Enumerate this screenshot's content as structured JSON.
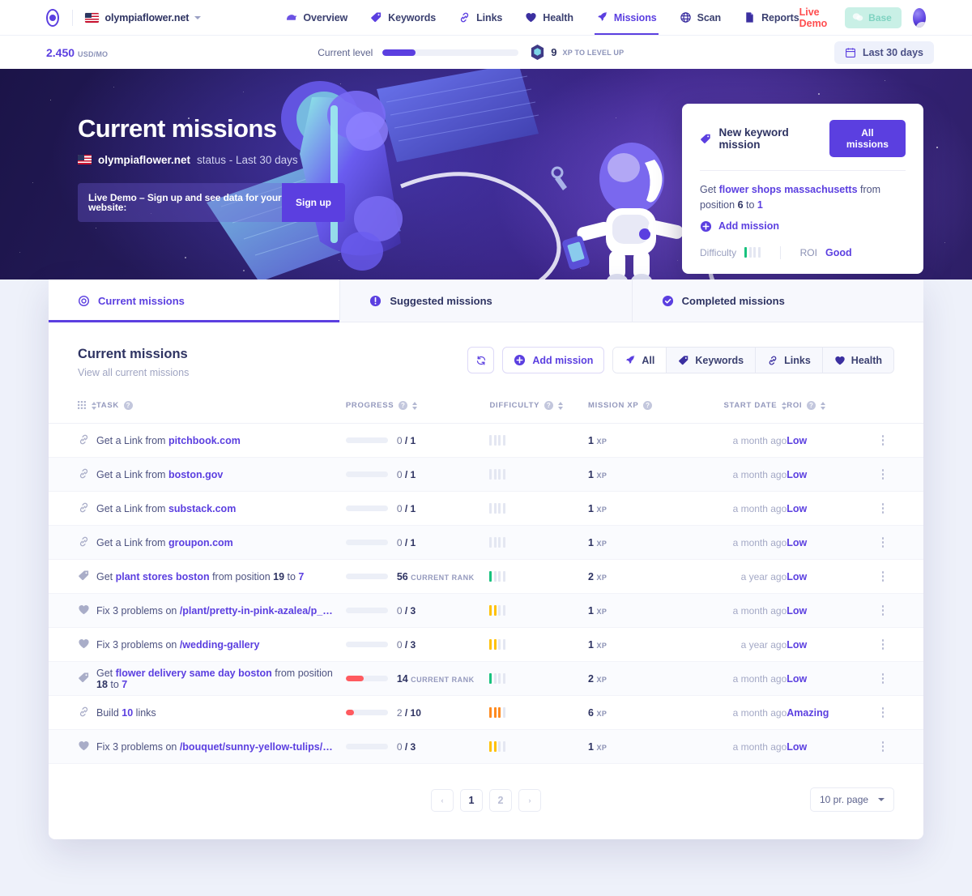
{
  "topnav": {
    "logo_icon": "target-logo-icon",
    "site": {
      "name": "olympiaflower.net",
      "flag": "us-flag-icon"
    },
    "items": [
      {
        "label": "Overview",
        "icon": "speedometer-icon",
        "active": false
      },
      {
        "label": "Keywords",
        "icon": "tag-icon",
        "active": false
      },
      {
        "label": "Links",
        "icon": "link-icon",
        "active": false
      },
      {
        "label": "Health",
        "icon": "heart-icon",
        "active": false
      },
      {
        "label": "Missions",
        "icon": "rocket-icon",
        "active": true
      },
      {
        "label": "Scan",
        "icon": "globe-icon",
        "active": false
      },
      {
        "label": "Reports",
        "icon": "document-icon",
        "active": false
      }
    ],
    "live_demo": "Live Demo",
    "plan_badge": "Base",
    "plan_icon": "chat-icon",
    "avatar": "user-avatar"
  },
  "subbar": {
    "mrr_value": "2.450",
    "mrr_unit": "USD/MO",
    "level_label": "Current level",
    "level_percent": 24,
    "xp_icon": "xp-gem-icon",
    "xp_value": "9",
    "xp_text": "XP TO LEVEL UP",
    "date_range": "Last 30 days",
    "date_icon": "calendar-icon"
  },
  "hero": {
    "title": "Current missions",
    "flag": "us-flag-icon",
    "subtitle_site": "olympiaflower.net",
    "subtitle_rest": "status - Last 30 days",
    "demo_text": "Live Demo – Sign up and see data for your website:",
    "signup_label": "Sign up"
  },
  "keyword_card": {
    "icon": "tag-icon",
    "title": "New keyword mission",
    "all_missions_label": "All missions",
    "line_prefix": "Get ",
    "keyword": "flower shops massachusetts",
    "line_mid": " from position ",
    "from_position": "6",
    "line_to": " to ",
    "to_position": "1",
    "add_mission_label": "Add mission",
    "add_icon": "plus-circle-icon",
    "difficulty_label": "Difficulty",
    "difficulty_level": 1,
    "difficulty_color": "#18c27e",
    "roi_label": "ROI",
    "roi_value": "Good"
  },
  "tabs": [
    {
      "label": "Current missions",
      "icon": "target-icon",
      "active": true
    },
    {
      "label": "Suggested missions",
      "icon": "exclamation-circle-icon",
      "active": false
    },
    {
      "label": "Completed missions",
      "icon": "check-circle-icon",
      "active": false
    }
  ],
  "panel": {
    "title": "Current missions",
    "subtitle": "View all current missions",
    "refresh_icon": "refresh-icon",
    "add_mission_label": "Add mission",
    "add_mission_icon": "plus-circle-icon",
    "filters": [
      {
        "label": "All",
        "icon": "rocket-icon",
        "active": true
      },
      {
        "label": "Keywords",
        "icon": "tag-icon",
        "active": false
      },
      {
        "label": "Links",
        "icon": "link-icon",
        "active": false
      },
      {
        "label": "Health",
        "icon": "heart-icon",
        "active": false
      }
    ]
  },
  "table": {
    "columns": [
      {
        "key": "icon",
        "label": "",
        "help": false,
        "sort": true
      },
      {
        "key": "task",
        "label": "TASK",
        "help": true,
        "sort": false
      },
      {
        "key": "progress",
        "label": "PROGRESS",
        "help": true,
        "sort": true
      },
      {
        "key": "difficulty",
        "label": "DIFFICULTY",
        "help": true,
        "sort": true
      },
      {
        "key": "xp",
        "label": "MISSION XP",
        "help": true,
        "sort": false
      },
      {
        "key": "date",
        "label": "START DATE",
        "help": false,
        "sort": true
      },
      {
        "key": "roi",
        "label": "ROI",
        "help": true,
        "sort": true
      }
    ],
    "rows": [
      {
        "icon": "link-icon",
        "task_prefix": "Get a Link from ",
        "task_highlight": "pitchbook.com",
        "task_suffix": "",
        "progress_fill": 0,
        "progress_text": "0",
        "progress_total": " / 1",
        "progress_mode": "fraction",
        "difficulty_level": 0,
        "difficulty_color": "#e4e7f2",
        "xp": "1",
        "xp_unit": "XP",
        "date": "a month ago",
        "roi": "Low"
      },
      {
        "icon": "link-icon",
        "task_prefix": "Get a Link from ",
        "task_highlight": "boston.gov",
        "task_suffix": "",
        "progress_fill": 0,
        "progress_text": "0",
        "progress_total": " / 1",
        "progress_mode": "fraction",
        "difficulty_level": 0,
        "difficulty_color": "#e4e7f2",
        "xp": "1",
        "xp_unit": "XP",
        "date": "a month ago",
        "roi": "Low"
      },
      {
        "icon": "link-icon",
        "task_prefix": "Get a Link from ",
        "task_highlight": "substack.com",
        "task_suffix": "",
        "progress_fill": 0,
        "progress_text": "0",
        "progress_total": " / 1",
        "progress_mode": "fraction",
        "difficulty_level": 0,
        "difficulty_color": "#e4e7f2",
        "xp": "1",
        "xp_unit": "XP",
        "date": "a month ago",
        "roi": "Low"
      },
      {
        "icon": "link-icon",
        "task_prefix": "Get a Link from ",
        "task_highlight": "groupon.com",
        "task_suffix": "",
        "progress_fill": 0,
        "progress_text": "0",
        "progress_total": " / 1",
        "progress_mode": "fraction",
        "difficulty_level": 0,
        "difficulty_color": "#e4e7f2",
        "xp": "1",
        "xp_unit": "XP",
        "date": "a month ago",
        "roi": "Low"
      },
      {
        "icon": "tag-icon",
        "task_prefix": "Get ",
        "task_highlight": "plant stores boston",
        "task_suffix": " from position 19 to 7",
        "progress_fill": 0,
        "progress_text": "56",
        "progress_total": "CURRENT RANK",
        "progress_mode": "rank",
        "difficulty_level": 1,
        "difficulty_color": "#18c27e",
        "xp": "2",
        "xp_unit": "XP",
        "date": "a year ago",
        "roi": "Low"
      },
      {
        "icon": "heart-icon",
        "task_prefix": "Fix 3 problems on ",
        "task_highlight": "/plant/pretty-in-pink-azalea/p_…",
        "task_suffix": "",
        "progress_fill": 0,
        "progress_text": "0",
        "progress_total": " / 3",
        "progress_mode": "fraction",
        "difficulty_level": 2,
        "difficulty_color": "#ffc107",
        "xp": "1",
        "xp_unit": "XP",
        "date": "a month ago",
        "roi": "Low"
      },
      {
        "icon": "heart-icon",
        "task_prefix": "Fix 3 problems on ",
        "task_highlight": "/wedding-gallery",
        "task_suffix": "",
        "progress_fill": 0,
        "progress_text": "0",
        "progress_total": " / 3",
        "progress_mode": "fraction",
        "difficulty_level": 2,
        "difficulty_color": "#ffc107",
        "xp": "1",
        "xp_unit": "XP",
        "date": "a year ago",
        "roi": "Low"
      },
      {
        "icon": "tag-icon",
        "task_prefix": "Get ",
        "task_highlight": "flower delivery same day boston",
        "task_suffix": " from position 18 to 7",
        "progress_fill": 42,
        "progress_text": "14",
        "progress_total": "CURRENT RANK",
        "progress_mode": "rank",
        "difficulty_level": 1,
        "difficulty_color": "#18c27e",
        "xp": "2",
        "xp_unit": "XP",
        "date": "a month ago",
        "roi": "Low"
      },
      {
        "icon": "link-icon",
        "task_prefix": "Build ",
        "task_highlight": "10",
        "task_suffix": " links",
        "progress_fill": 20,
        "progress_text": "2",
        "progress_total": " / 10",
        "progress_mode": "fraction",
        "difficulty_level": 3,
        "difficulty_color": "#ff8a1f",
        "xp": "6",
        "xp_unit": "XP",
        "date": "a month ago",
        "roi": "Amazing"
      },
      {
        "icon": "heart-icon",
        "task_prefix": "Fix 3 problems on ",
        "task_highlight": "/bouquet/sunny-yellow-tulips/…",
        "task_suffix": "",
        "progress_fill": 0,
        "progress_text": "0",
        "progress_total": " / 3",
        "progress_mode": "fraction",
        "difficulty_level": 2,
        "difficulty_color": "#ffc107",
        "xp": "1",
        "xp_unit": "XP",
        "date": "a month ago",
        "roi": "Low"
      }
    ]
  },
  "pagination": {
    "prev": "‹",
    "pages": [
      "1",
      "2"
    ],
    "current": "1",
    "next": "›",
    "per_page": "10 pr. page"
  },
  "colors": {
    "brand": "#5b3fe0",
    "danger": "#ff5a5f",
    "good": "#18c27e",
    "warn": "#ffc107",
    "orange": "#ff8a1f"
  }
}
